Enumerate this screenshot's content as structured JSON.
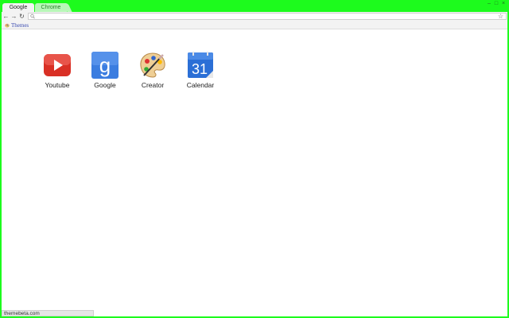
{
  "tabs": [
    {
      "label": "Google",
      "active": true
    },
    {
      "label": "Chrome",
      "active": false
    }
  ],
  "window_controls": {
    "minimize": "–",
    "maximize": "□",
    "close": "×"
  },
  "toolbar": {
    "back_glyph": "←",
    "forward_glyph": "→",
    "reload_glyph": "↻",
    "omnibox_value": "",
    "star_glyph": "☆"
  },
  "bookmarks": [
    {
      "label": "Themes",
      "icon": "palette-icon"
    }
  ],
  "apps": [
    {
      "label": "Youtube",
      "icon": "youtube-icon"
    },
    {
      "label": "Google",
      "icon": "google-icon"
    },
    {
      "label": "Creator",
      "icon": "palette-icon"
    },
    {
      "label": "Calendar",
      "icon": "calendar-icon",
      "day": "31"
    }
  ],
  "status": {
    "text": "themebeta.com"
  },
  "colors": {
    "frame": "#1dfb1d",
    "inactive_tab": "#b9f7b9",
    "youtube": "#d93025",
    "google_blue": "#3b7de0"
  }
}
